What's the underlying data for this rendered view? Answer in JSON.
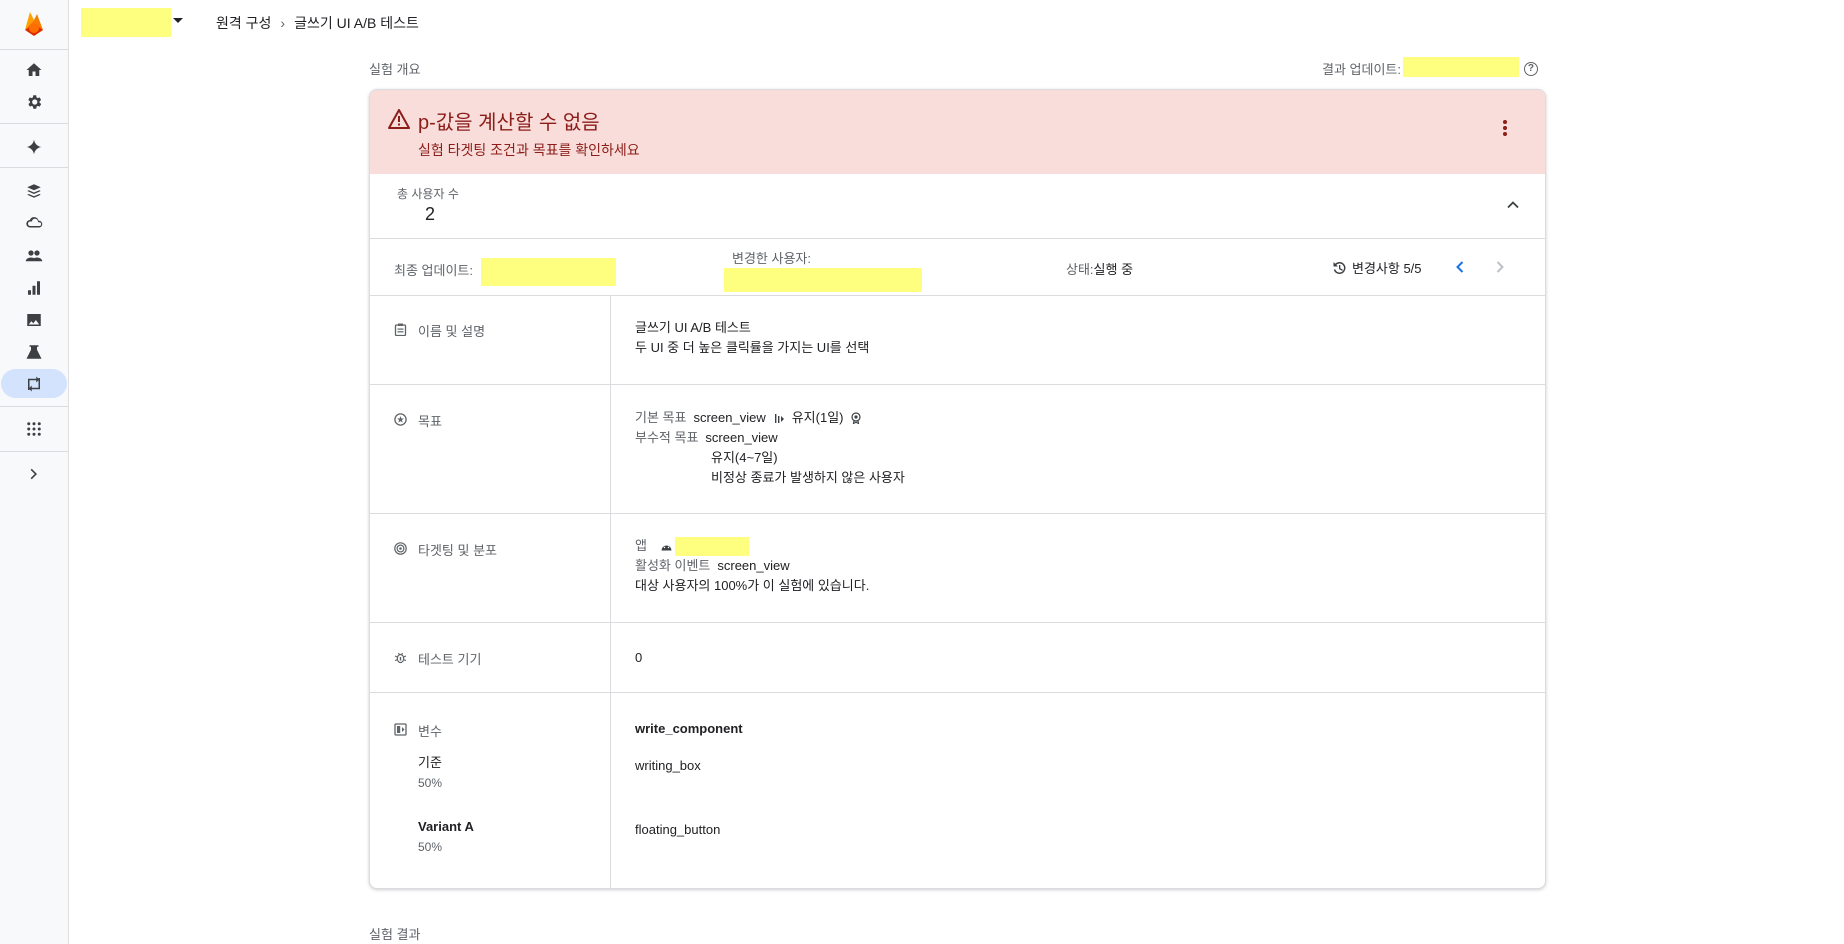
{
  "breadcrumb": {
    "parent": "원격 구성",
    "current": "글쓰기 UI A/B 테스트"
  },
  "overview": {
    "title": "실험 개요",
    "results_update_label": "결과 업데이트:"
  },
  "alert": {
    "title": "p-값을 계산할 수 없음",
    "subtitle": "실험 타겟팅 조건과 목표를 확인하세요"
  },
  "summary": {
    "total_users_label": "총 사용자 수",
    "total_users_value": "2"
  },
  "meta": {
    "last_updated_label": "최종 업데이트:",
    "changed_by_label": "변경한 사용자:",
    "status_label": "상태:",
    "status_value": "실행 중",
    "history_label": "변경사항 5/5"
  },
  "sections": {
    "name": {
      "title": "이름 및 설명",
      "name": "글쓰기 UI A/B 테스트",
      "description": "두 UI 중 더 높은 클릭률을 가지는 UI를 선택"
    },
    "goals": {
      "title": "목표",
      "primary_label": "기본 목표",
      "primary_event": "screen_view",
      "primary_metric": "유지(1일)",
      "secondary_label": "부수적 목표",
      "secondary_items": [
        "screen_view",
        "유지(4~7일)",
        "비정상 종료가 발생하지 않은 사용자"
      ]
    },
    "targeting": {
      "title": "타겟팅 및 분포",
      "app_label": "앱",
      "activation_label": "활성화 이벤트",
      "activation_event": "screen_view",
      "exposure_text": "대상 사용자의 100%가 이 실험에 있습니다."
    },
    "test_devices": {
      "title": "테스트 기기",
      "value": "0"
    },
    "variants": {
      "title": "변수",
      "param": "write_component",
      "items": [
        {
          "name": "기준",
          "percent": "50%",
          "value": "writing_box"
        },
        {
          "name": "Variant A",
          "percent": "50%",
          "value": "floating_button"
        }
      ]
    }
  },
  "results": {
    "title": "실험 결과"
  },
  "colors": {
    "alert_bg": "#f8dddb",
    "alert_text": "#8c1d18",
    "highlight": "#ffff7f",
    "nav_active": "#d3e3fd",
    "accent": "#1a73e8"
  },
  "icons": [
    "firebase-logo-icon",
    "home-icon",
    "settings-icon",
    "gemini-spark-icon",
    "database-icon",
    "cloud-icon",
    "users-icon",
    "analytics-icon",
    "image-icon",
    "lab-flask-icon",
    "remote-config-icon",
    "apps-grid-icon",
    "expand-rail-icon"
  ]
}
